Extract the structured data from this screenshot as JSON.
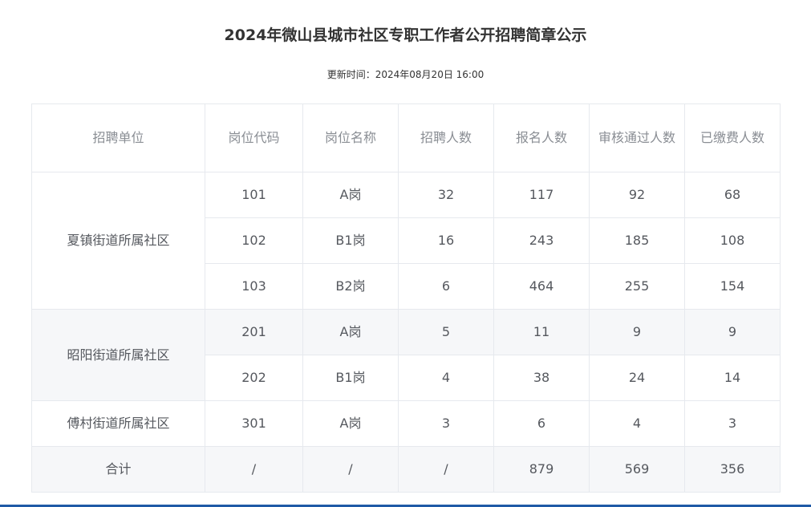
{
  "title": "2024年微山县城市社区专职工作者公开招聘简章公示",
  "update_time": "更新时间：2024年08月20日 16:00",
  "table": {
    "headers": [
      "招聘单位",
      "岗位代码",
      "岗位名称",
      "招聘人数",
      "报名人数",
      "审核通过人数",
      "已缴费人数"
    ],
    "groups": [
      {
        "unit": "夏镇街道所属社区",
        "rows": [
          [
            "101",
            "A岗",
            "32",
            "117",
            "92",
            "68"
          ],
          [
            "102",
            "B1岗",
            "16",
            "243",
            "185",
            "108"
          ],
          [
            "103",
            "B2岗",
            "6",
            "464",
            "255",
            "154"
          ]
        ]
      },
      {
        "unit": "昭阳街道所属社区",
        "rows": [
          [
            "201",
            "A岗",
            "5",
            "11",
            "9",
            "9"
          ],
          [
            "202",
            "B1岗",
            "4",
            "38",
            "24",
            "14"
          ]
        ]
      },
      {
        "unit": "傅村街道所属社区",
        "rows": [
          [
            "301",
            "A岗",
            "3",
            "6",
            "4",
            "3"
          ]
        ]
      }
    ],
    "total": [
      "合计",
      "/",
      "/",
      "/",
      "879",
      "569",
      "356"
    ]
  },
  "colors": {
    "header_text": "#8a8e94",
    "cell_text": "#55585e",
    "border": "#e6e9ee",
    "stripe": "#f6f7f9",
    "bottom_accent": "#1f5aa6"
  }
}
